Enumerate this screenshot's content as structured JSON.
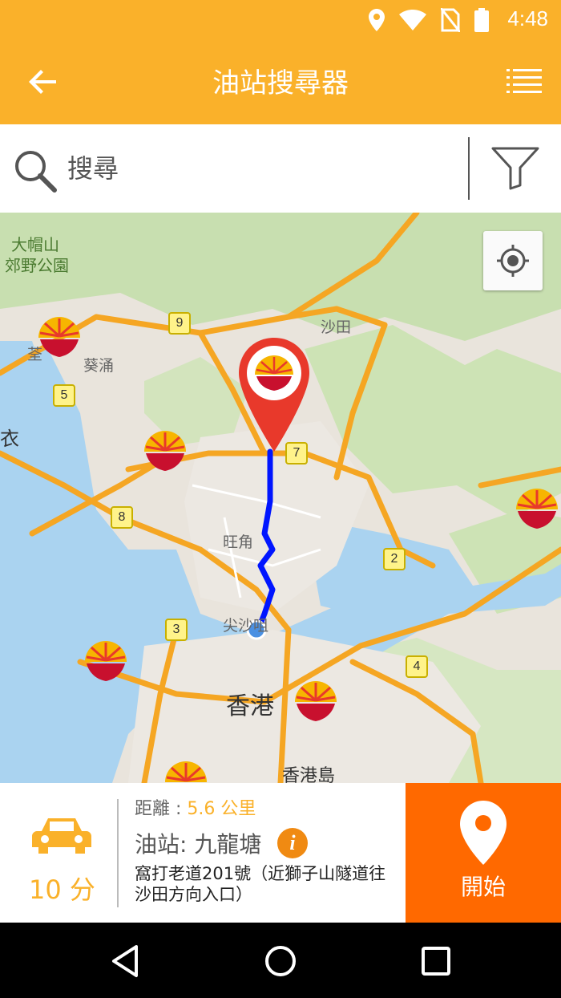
{
  "status": {
    "time": "4:48"
  },
  "app": {
    "title": "油站搜尋器"
  },
  "search": {
    "placeholder": "搜尋"
  },
  "map": {
    "labels": {
      "tai_mo_shan": "大帽山",
      "country_park": "郊野公園",
      "sha_tin": "沙田",
      "kwai_chung": "葵涌",
      "tsuen": "荃",
      "yi": "衣",
      "mong_kok": "旺角",
      "tsim_sha_tsui": "尖沙咀",
      "hong_kong": "香港",
      "hk_island": "香港島"
    },
    "route_shields": [
      "9",
      "5",
      "7",
      "8",
      "2",
      "3",
      "4"
    ]
  },
  "trip": {
    "time": "10 分",
    "distance_label": "距離 : ",
    "distance_value": "5.6 公里",
    "station": "油站: 九龍塘",
    "info": "i",
    "address": "窩打老道201號（近獅子山隧道往沙田方向入口）",
    "start_label": "開始"
  },
  "colors": {
    "accent": "#fab12a",
    "start": "#ff6900",
    "route": "#0015ff",
    "pin": "#e8392b"
  }
}
